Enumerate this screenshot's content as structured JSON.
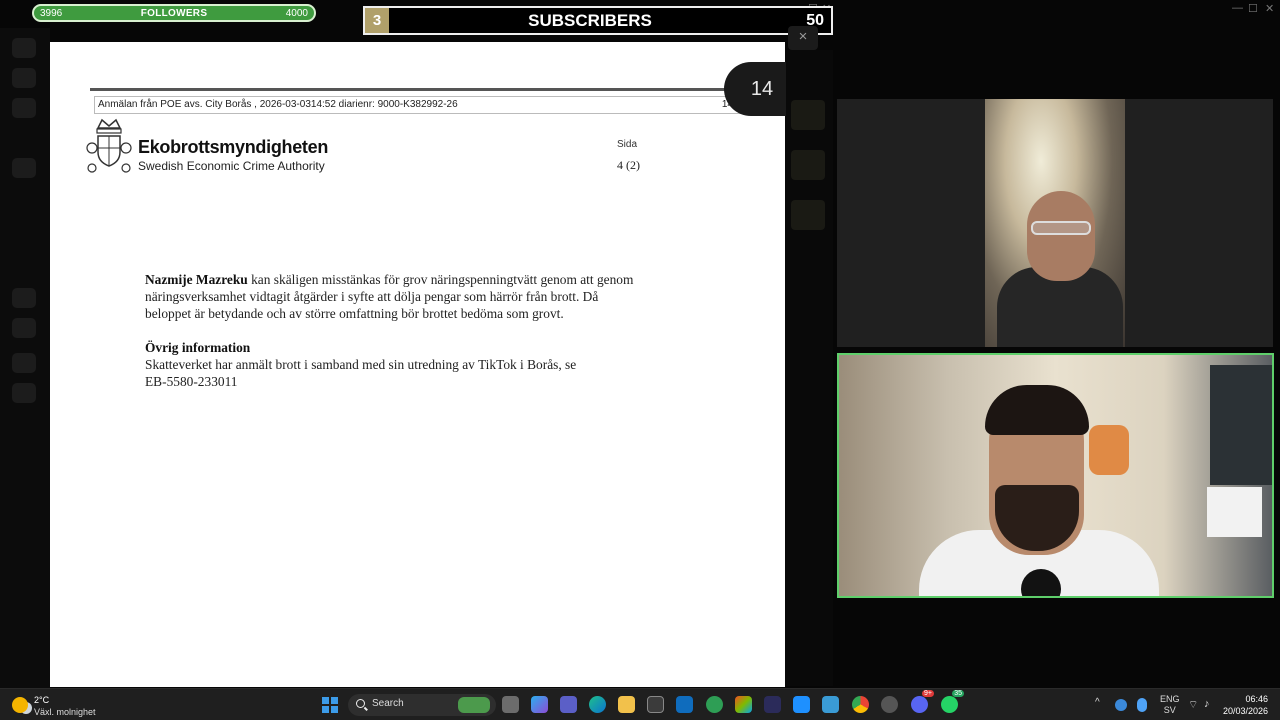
{
  "followers": {
    "min": "3996",
    "label": "FOLLOWERS",
    "max": "4000",
    "progress": 0.0
  },
  "subscribers": {
    "count": "3",
    "label": "SUBSCRIBERS",
    "goal": "50"
  },
  "document": {
    "page_number": "14",
    "header_line": "Anmälan från POE avs. City Borås , 2026-03-0314:52   diarienr: 9000-K382992-26",
    "header_page": "14",
    "org_name": "Ekobrottsmyndigheten",
    "org_name_en": "Swedish Economic Crime Authority",
    "page_label": "Sida",
    "page_value": "4 (2)",
    "paragraph1_name": "Nazmije Mazreku",
    "paragraph1_line1": " kan skäligen misstänkas för grov näringspenningtvätt genom att genom",
    "paragraph1_line2": "näringsverksamhet vidtagit åtgärder i syfte att dölja pengar som härrör från brott. Då",
    "paragraph1_line3": "beloppet är betydande och av större omfattning bör brottet bedöma som grovt.",
    "section_heading": "Övrig information",
    "paragraph2_line1": "Skatteverket har anmält brott i samband med sin utredning av TikTok i Borås, se",
    "paragraph2_line2": "EB-5580-233011"
  },
  "taskbar": {
    "weather_temp": "2°C",
    "weather_desc": "Växl. molnighet",
    "search_placeholder": "Search",
    "lang_top": "ENG",
    "lang_bottom": "SV",
    "time": "06:46",
    "date": "20/03/2026",
    "discord_badge": "9+",
    "whatsapp_badge": "35"
  },
  "colors": {
    "follower_bar": "#3f9b3f",
    "sub_badge": "#b0a06a",
    "cam_border": "#5fcf6b",
    "taskbar": "#1f1f1f"
  }
}
